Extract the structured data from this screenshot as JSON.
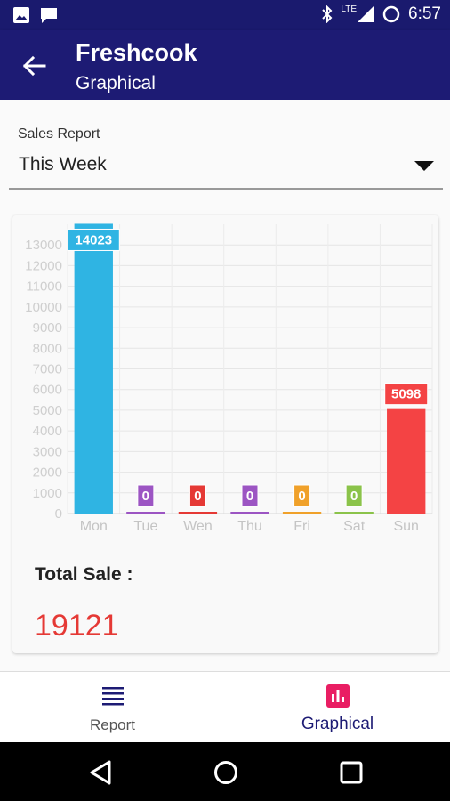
{
  "status_bar": {
    "time": "6:57",
    "network": "LTE"
  },
  "app_bar": {
    "title": "Freshcook",
    "subtitle": "Graphical"
  },
  "report": {
    "label": "Sales Report",
    "selected_period": "This Week"
  },
  "chart_data": {
    "type": "bar",
    "categories": [
      "Mon",
      "Tue",
      "Wen",
      "Thu",
      "Fri",
      "Sat",
      "Sun"
    ],
    "values": [
      14023,
      0,
      0,
      0,
      0,
      0,
      5098
    ],
    "colors": [
      "#2fb4e3",
      "#9c55c3",
      "#e53935",
      "#9c55c3",
      "#f0a12a",
      "#8bc34a",
      "#f44344"
    ],
    "ylim": [
      0,
      14000
    ],
    "yticks": [
      0,
      1000,
      2000,
      3000,
      4000,
      5000,
      6000,
      7000,
      8000,
      9000,
      10000,
      11000,
      12000,
      13000
    ],
    "grid": true,
    "value_labels": true
  },
  "totals": {
    "label": "Total Sale :",
    "value": "19121"
  },
  "bottom_nav": {
    "report_label": "Report",
    "graphical_label": "Graphical"
  }
}
